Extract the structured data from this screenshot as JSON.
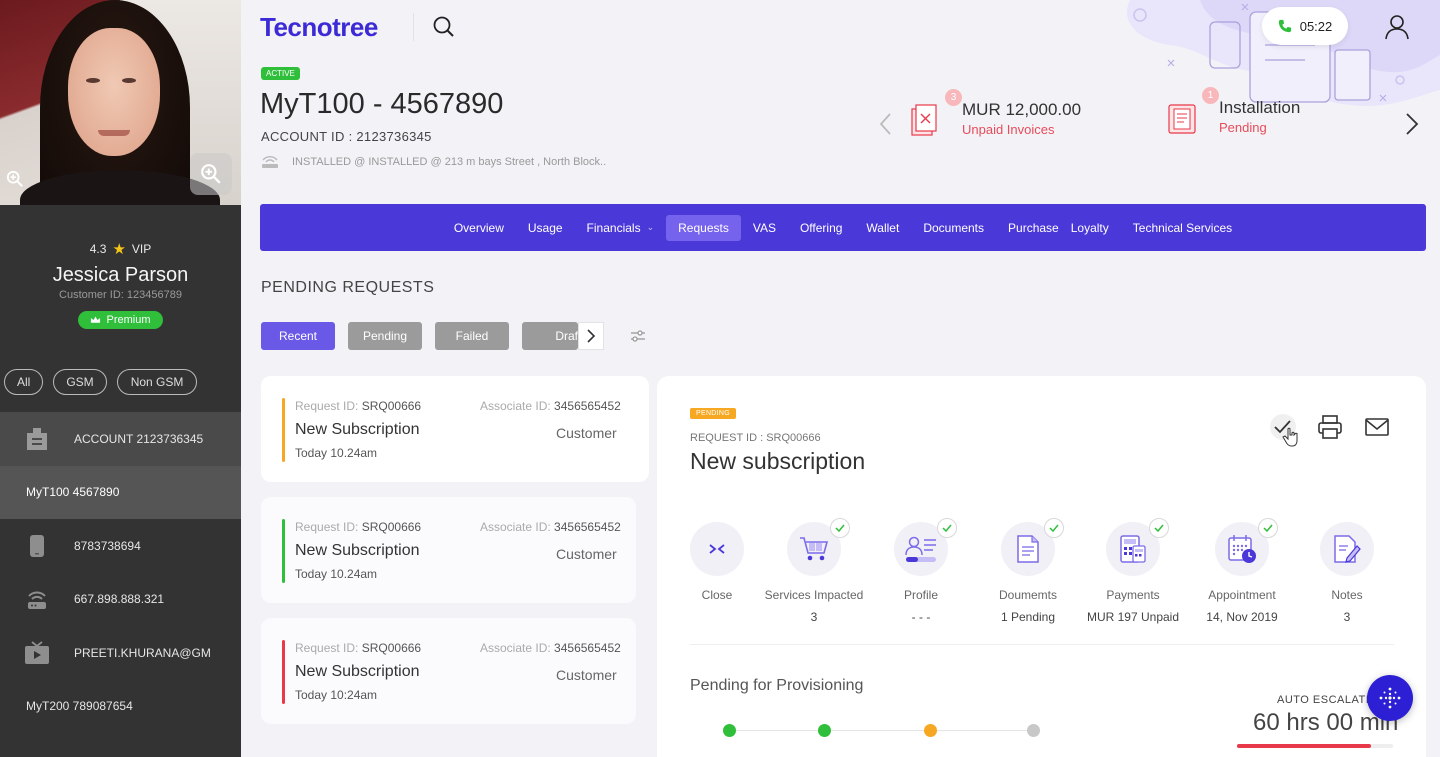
{
  "brand": {
    "logo": "Tecnotree",
    "accent": "#4b38d8"
  },
  "call_timer": "05:22",
  "customer": {
    "rating": "4.3",
    "tier": "VIP",
    "name": "Jessica Parson",
    "id_line": "Customer ID: 123456789",
    "badge": "Premium"
  },
  "sidebar_filters": [
    "All",
    "GSM",
    "Non GSM"
  ],
  "sidebar_accounts": [
    {
      "label": "ACCOUNT 2123736345",
      "icon": "building-icon"
    },
    {
      "label": "MyT100  4567890",
      "icon": ""
    },
    {
      "label": "8783738694",
      "icon": "mobile-icon"
    },
    {
      "label": "667.898.888.321",
      "icon": "router-icon"
    },
    {
      "label": "PREETI.KHURANA@GM",
      "icon": "tv-icon"
    },
    {
      "label": "MyT200 789087654",
      "icon": ""
    }
  ],
  "account": {
    "status": "ACTIVE",
    "title": "MyT100 - 4567890",
    "id_line": "ACCOUNT ID :  2123736345",
    "installed": "INSTALLED @  INSTALLED @ 213 m bays Street , North Block.."
  },
  "summary": [
    {
      "count": "3",
      "line1": "MUR 12,000.00",
      "line2": "Unpaid Invoices",
      "icon": "invoice-icon"
    },
    {
      "count": "1",
      "line1": "Installation",
      "line2": "Pending",
      "icon": "installation-icon"
    }
  ],
  "tabs": [
    {
      "label": "Overview"
    },
    {
      "label": "Usage"
    },
    {
      "label": "Financials",
      "dropdown": true
    },
    {
      "label": "Requests",
      "active": true
    },
    {
      "label": "VAS"
    },
    {
      "label": "Offering"
    },
    {
      "label": "Wallet"
    },
    {
      "label": "Documents"
    },
    {
      "label": "Purchase"
    },
    {
      "label": "Loyalty"
    },
    {
      "label": "Technical Services"
    }
  ],
  "pending": {
    "title": "PENDING REQUESTS",
    "filters": [
      "Recent",
      "Pending",
      "Failed",
      "Draf"
    ],
    "requests": [
      {
        "id_label": "Request ID:",
        "id": "SRQ00666",
        "assoc_label": "Associate ID:",
        "assoc": "3456565452",
        "type": "New Subscription",
        "who": "Customer",
        "time": "Today 10.24am",
        "color": "#f7a823"
      },
      {
        "id_label": "Request ID:",
        "id": "SRQ00666",
        "assoc_label": "Associate ID:",
        "assoc": "3456565452",
        "type": "New Subscription",
        "who": "Customer",
        "time": "Today 10.24am",
        "color": "#2fbf3b"
      },
      {
        "id_label": "Request ID:",
        "id": "SRQ00666",
        "assoc_label": "Associate ID:",
        "assoc": "3456565452",
        "type": "New Subscription",
        "who": "Customer",
        "time": "Today 10:24am",
        "color": "#e8394a"
      }
    ]
  },
  "detail": {
    "status": "PENDING",
    "req_label": "REQUEST ID : SRQ00666",
    "title": "New subscription",
    "steps": [
      {
        "label": "Close",
        "value": "",
        "icon": "collapse-icon",
        "checked": false
      },
      {
        "label": "Services Impacted",
        "value": "3",
        "icon": "cart-icon",
        "checked": true
      },
      {
        "label": "Profile",
        "value": "- - -",
        "icon": "profile-icon",
        "checked": true
      },
      {
        "label": "Doumemts",
        "value": "1 Pending",
        "icon": "document-icon",
        "checked": true
      },
      {
        "label": "Payments",
        "value": "MUR 197 Unpaid",
        "icon": "calculator-icon",
        "checked": true
      },
      {
        "label": "Appointment",
        "value": "14, Nov 2019",
        "icon": "calendar-icon",
        "checked": true
      },
      {
        "label": "Notes",
        "value": "3",
        "icon": "notes-icon",
        "checked": false
      }
    ],
    "provisioning_title": "Pending for Provisioning",
    "provisioning_dots": [
      "#2fbf3b",
      "#2fbf3b",
      "#f7a823",
      "#c8c8c8"
    ],
    "escalation_label": "AUTO ESCALATIO",
    "escalation_value": "60 hrs 00 min",
    "escalation_progress": 0.86
  }
}
